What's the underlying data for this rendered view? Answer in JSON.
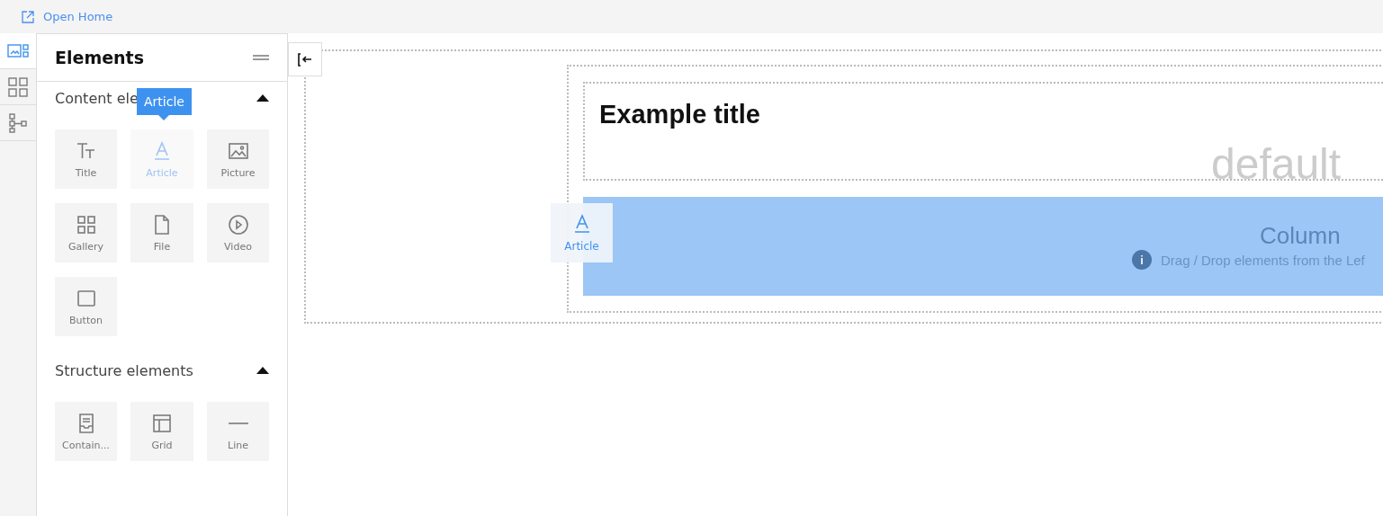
{
  "top_bar": {
    "link": "Open Home"
  },
  "rail_tabs": [
    {
      "kind": "elements",
      "selected": true
    },
    {
      "kind": "layouts",
      "selected": false
    },
    {
      "kind": "tree",
      "selected": false
    }
  ],
  "panel": {
    "title": "Elements",
    "sections": [
      {
        "title": "Content ele",
        "expanded": true,
        "items": [
          {
            "kind": "title",
            "label": "Title",
            "dragging": false
          },
          {
            "kind": "article",
            "label": "Article",
            "dragging": true
          },
          {
            "kind": "picture",
            "label": "Picture",
            "dragging": false
          },
          {
            "kind": "gallery",
            "label": "Gallery",
            "dragging": false
          },
          {
            "kind": "file",
            "label": "File",
            "dragging": false
          },
          {
            "kind": "video",
            "label": "Video",
            "dragging": false
          },
          {
            "kind": "button",
            "label": "Button",
            "dragging": false
          }
        ]
      },
      {
        "title": "Structure elements",
        "expanded": true,
        "items": [
          {
            "kind": "container",
            "label": "Contain...",
            "dragging": false
          },
          {
            "kind": "grid",
            "label": "Grid",
            "dragging": false
          },
          {
            "kind": "line",
            "label": "Line",
            "dragging": false
          }
        ]
      }
    ]
  },
  "tooltip": "Article",
  "canvas": {
    "title": "Example title",
    "layout_label": "default",
    "column_label": "Column",
    "column_hint": "Drag / Drop elements from the Lef",
    "drag_ghost": {
      "kind": "article",
      "label": "Article"
    }
  }
}
